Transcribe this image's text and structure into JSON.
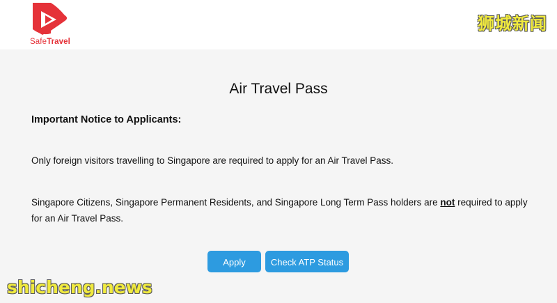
{
  "header": {
    "logo_prefix": "Safe",
    "logo_suffix": "Travel",
    "brand_color": "#e53239"
  },
  "watermark": {
    "cn": "狮城新闻",
    "site": "shicheng.news"
  },
  "main": {
    "title": "Air Travel Pass",
    "notice_heading": "Important Notice to Applicants:",
    "paragraph1": "Only foreign visitors travelling to Singapore are required to apply for an Air Travel Pass.",
    "paragraph2_before": "Singapore Citizens, Singapore Permanent Residents, and Singapore Long Term Pass holders are ",
    "paragraph2_emphasis": "not",
    "paragraph2_after": " required to apply for an Air Travel Pass."
  },
  "buttons": {
    "apply_label": "Apply",
    "check_status_label": "Check ATP Status",
    "color": "#2d9be0"
  }
}
